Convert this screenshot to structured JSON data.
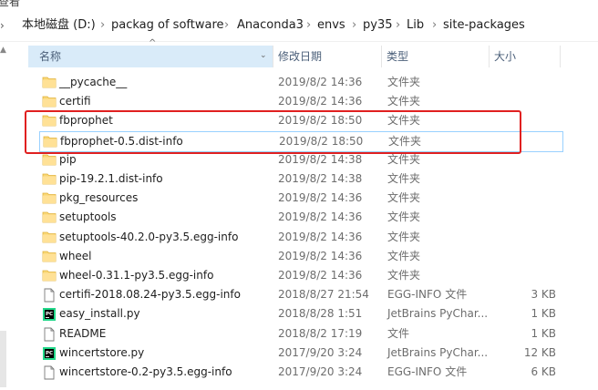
{
  "topline": "查看",
  "breadcrumb": [
    "本地磁盘 (D:)",
    "packag of software",
    "Anaconda3",
    "envs",
    "py35",
    "Lib",
    "site-packages"
  ],
  "columns": {
    "name": "名称",
    "date": "修改日期",
    "type": "类型",
    "size": "大小"
  },
  "files": [
    {
      "name": "__pycache__",
      "date": "2019/8/2 14:36",
      "type": "文件夹",
      "size": "",
      "icon": "folder-icon"
    },
    {
      "name": "certifi",
      "date": "2019/8/2 14:36",
      "type": "文件夹",
      "size": "",
      "icon": "folder-icon"
    },
    {
      "name": "fbprophet",
      "date": "2019/8/2 18:50",
      "type": "文件夹",
      "size": "",
      "icon": "folder-icon"
    },
    {
      "name": "fbprophet-0.5.dist-info",
      "date": "2019/8/2 18:50",
      "type": "文件夹",
      "size": "",
      "icon": "folder-icon",
      "selected": true
    },
    {
      "name": "pip",
      "date": "2019/8/2 14:38",
      "type": "文件夹",
      "size": "",
      "icon": "folder-icon"
    },
    {
      "name": "pip-19.2.1.dist-info",
      "date": "2019/8/2 14:38",
      "type": "文件夹",
      "size": "",
      "icon": "folder-icon"
    },
    {
      "name": "pkg_resources",
      "date": "2019/8/2 14:36",
      "type": "文件夹",
      "size": "",
      "icon": "folder-icon"
    },
    {
      "name": "setuptools",
      "date": "2019/8/2 14:36",
      "type": "文件夹",
      "size": "",
      "icon": "folder-icon"
    },
    {
      "name": "setuptools-40.2.0-py3.5.egg-info",
      "date": "2019/8/2 14:36",
      "type": "文件夹",
      "size": "",
      "icon": "folder-icon"
    },
    {
      "name": "wheel",
      "date": "2019/8/2 14:36",
      "type": "文件夹",
      "size": "",
      "icon": "folder-icon"
    },
    {
      "name": "wheel-0.31.1-py3.5.egg-info",
      "date": "2019/8/2 14:36",
      "type": "文件夹",
      "size": "",
      "icon": "folder-icon"
    },
    {
      "name": "certifi-2018.08.24-py3.5.egg-info",
      "date": "2018/8/27 21:54",
      "type": "EGG-INFO 文件",
      "size": "3 KB",
      "icon": "file-icon"
    },
    {
      "name": "easy_install.py",
      "date": "2018/8/28 1:51",
      "type": "JetBrains PyChar...",
      "size": "1 KB",
      "icon": "pycharm-file-icon"
    },
    {
      "name": "README",
      "date": "2018/8/2 17:19",
      "type": "文件",
      "size": "1 KB",
      "icon": "file-icon"
    },
    {
      "name": "wincertstore.py",
      "date": "2017/9/20 3:24",
      "type": "JetBrains PyChar...",
      "size": "12 KB",
      "icon": "pycharm-file-icon"
    },
    {
      "name": "wincertstore-0.2-py3.5.egg-info",
      "date": "2017/9/20 3:24",
      "type": "EGG-INFO 文件",
      "size": "6 KB",
      "icon": "file-icon"
    }
  ],
  "colors": {
    "folder": "#f8d775",
    "folder_dark": "#e8b931",
    "highlight": "#e02020",
    "selection_border": "#99d1ff",
    "header_bg": "#d9ebf9"
  }
}
